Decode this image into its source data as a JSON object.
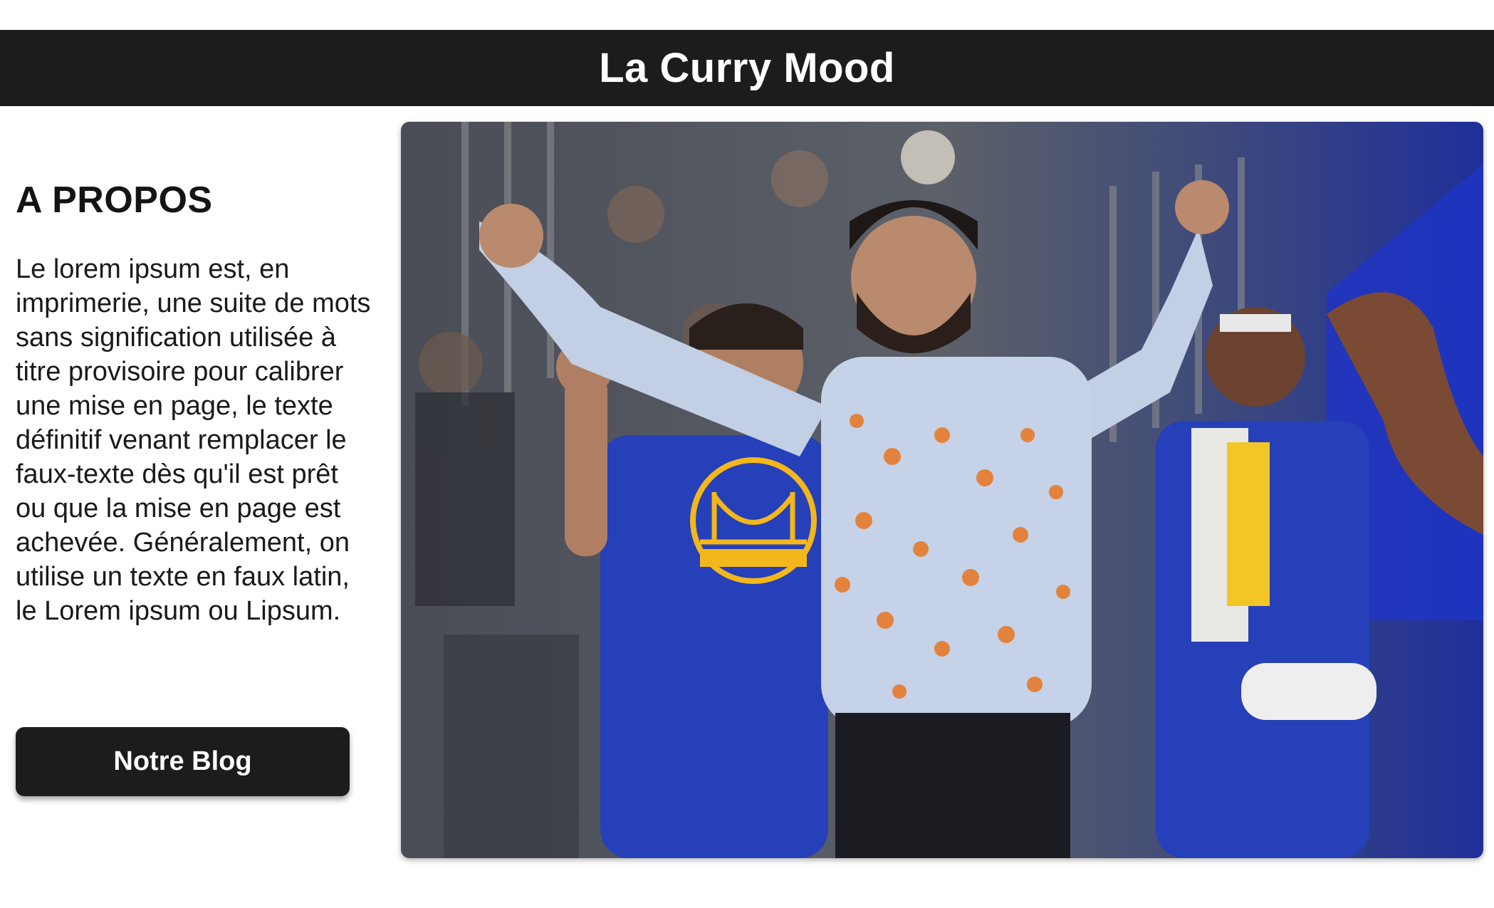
{
  "header": {
    "title": "La Curry Mood"
  },
  "about": {
    "heading": "A PROPOS",
    "text": "Le lorem ipsum est, en imprimerie, une suite de mots sans signification utilisée à titre provisoire pour calibrer une mise en page, le texte définitif venant remplacer le faux-texte dès qu'il est prêt ou que la mise en page est achevée. Généralement, on utilise un texte en faux latin, le Lorem ipsum ou Lipsum.",
    "button_label": "Notre Blog"
  },
  "colors": {
    "header_bg": "#1c1c1c",
    "button_bg": "#1c1c1c",
    "text": "#141414"
  }
}
